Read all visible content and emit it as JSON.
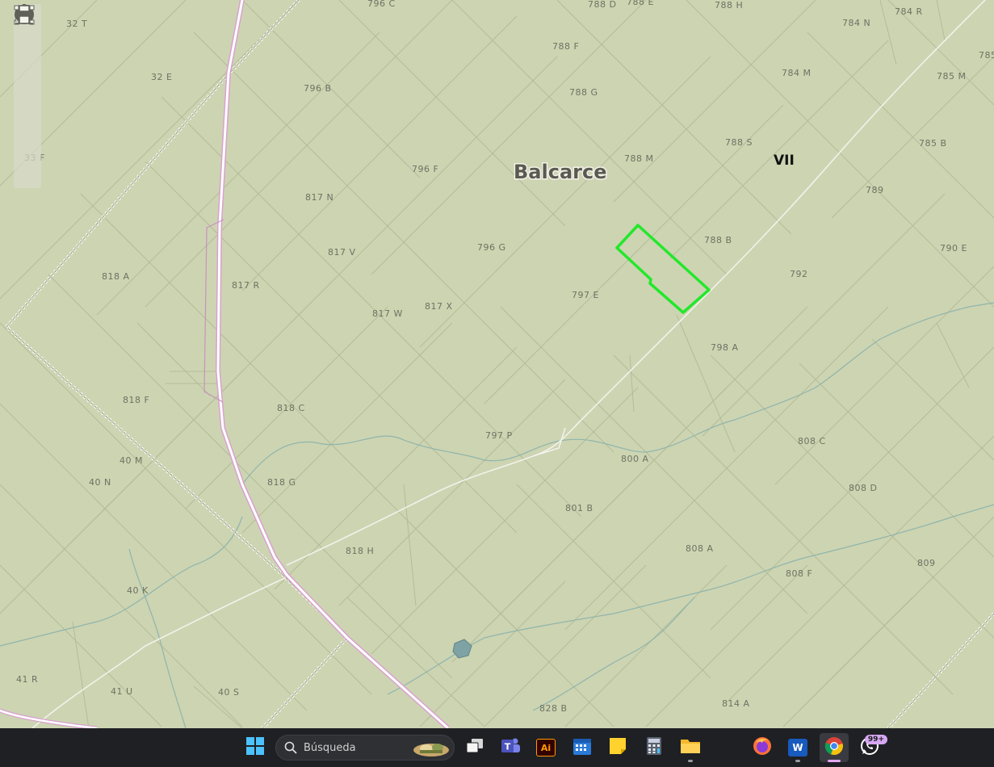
{
  "map": {
    "city_label": "Balcarce",
    "zone_label": "VII",
    "parcels": [
      {
        "id": "p-796c",
        "label": "796 C"
      },
      {
        "id": "p-788d",
        "label": "788 D"
      },
      {
        "id": "p-788e",
        "label": "788 E"
      },
      {
        "id": "p-788h",
        "label": "788 H"
      },
      {
        "id": "p-784r",
        "label": "784 R"
      },
      {
        "id": "p-784n",
        "label": "784 N"
      },
      {
        "id": "p-785",
        "label": "785"
      },
      {
        "id": "p-32t",
        "label": "32 T"
      },
      {
        "id": "p-788f",
        "label": "788 F"
      },
      {
        "id": "p-32e",
        "label": "32 E"
      },
      {
        "id": "p-784m",
        "label": "784 M"
      },
      {
        "id": "p-785m",
        "label": "785 M"
      },
      {
        "id": "p-796b",
        "label": "796 B"
      },
      {
        "id": "p-788g",
        "label": "788 G"
      },
      {
        "id": "p-788s",
        "label": "788 S"
      },
      {
        "id": "p-785b",
        "label": "785 B"
      },
      {
        "id": "p-33f",
        "label": "33 F"
      },
      {
        "id": "p-788m",
        "label": "788 M"
      },
      {
        "id": "p-796f",
        "label": "796 F"
      },
      {
        "id": "p-789",
        "label": "789"
      },
      {
        "id": "p-817n",
        "label": "817 N"
      },
      {
        "id": "p-788b",
        "label": "788 B"
      },
      {
        "id": "p-796g",
        "label": "796 G"
      },
      {
        "id": "p-790e",
        "label": "790 E"
      },
      {
        "id": "p-817v",
        "label": "817 V"
      },
      {
        "id": "p-792",
        "label": "792"
      },
      {
        "id": "p-818a",
        "label": "818 A"
      },
      {
        "id": "p-817r",
        "label": "817 R"
      },
      {
        "id": "p-797e",
        "label": "797 E"
      },
      {
        "id": "p-817x",
        "label": "817 X"
      },
      {
        "id": "p-817w",
        "label": "817 W"
      },
      {
        "id": "p-798a",
        "label": "798 A"
      },
      {
        "id": "p-818f",
        "label": "818 F"
      },
      {
        "id": "p-818c",
        "label": "818 C"
      },
      {
        "id": "p-797p",
        "label": "797 P"
      },
      {
        "id": "p-808c",
        "label": "808 C"
      },
      {
        "id": "p-40m",
        "label": "40 M"
      },
      {
        "id": "p-800a",
        "label": "800 A"
      },
      {
        "id": "p-40n",
        "label": "40 N"
      },
      {
        "id": "p-818g",
        "label": "818 G"
      },
      {
        "id": "p-808d",
        "label": "808 D"
      },
      {
        "id": "p-801b",
        "label": "801 B"
      },
      {
        "id": "p-818h",
        "label": "818 H"
      },
      {
        "id": "p-808a",
        "label": "808 A"
      },
      {
        "id": "p-809",
        "label": "809"
      },
      {
        "id": "p-808f",
        "label": "808 F"
      },
      {
        "id": "p-40k",
        "label": "40 K"
      },
      {
        "id": "p-41r",
        "label": "41 R"
      },
      {
        "id": "p-41u",
        "label": "41 U"
      },
      {
        "id": "p-40s",
        "label": "40 S"
      },
      {
        "id": "p-828b",
        "label": "828 B"
      },
      {
        "id": "p-814a",
        "label": "814 A"
      }
    ],
    "selection_color": "#22e82a",
    "road_color": "#d8a2cf"
  },
  "tools": [
    {
      "icon": "hand-pan-icon"
    },
    {
      "icon": "zoom-in-icon"
    },
    {
      "icon": "zoom-out-icon"
    },
    {
      "icon": "info-icon"
    },
    {
      "icon": "select-box-icon"
    },
    {
      "icon": "measure-icon"
    },
    {
      "icon": "print-icon"
    }
  ],
  "taskbar": {
    "search_placeholder": "Búsqueda",
    "apps": [
      {
        "icon": "windows-start-icon"
      },
      {
        "icon": "task-view-icon"
      },
      {
        "icon": "teams-icon"
      },
      {
        "icon": "illustrator-icon",
        "text": "Ai"
      },
      {
        "icon": "calendar-icon"
      },
      {
        "icon": "sticky-notes-icon"
      },
      {
        "icon": "calculator-icon"
      },
      {
        "icon": "file-explorer-icon"
      },
      {
        "icon": "firefox-icon"
      },
      {
        "icon": "word-icon",
        "text": "W"
      },
      {
        "icon": "chrome-icon"
      },
      {
        "icon": "whatsapp-icon",
        "badge": "99+"
      }
    ]
  }
}
